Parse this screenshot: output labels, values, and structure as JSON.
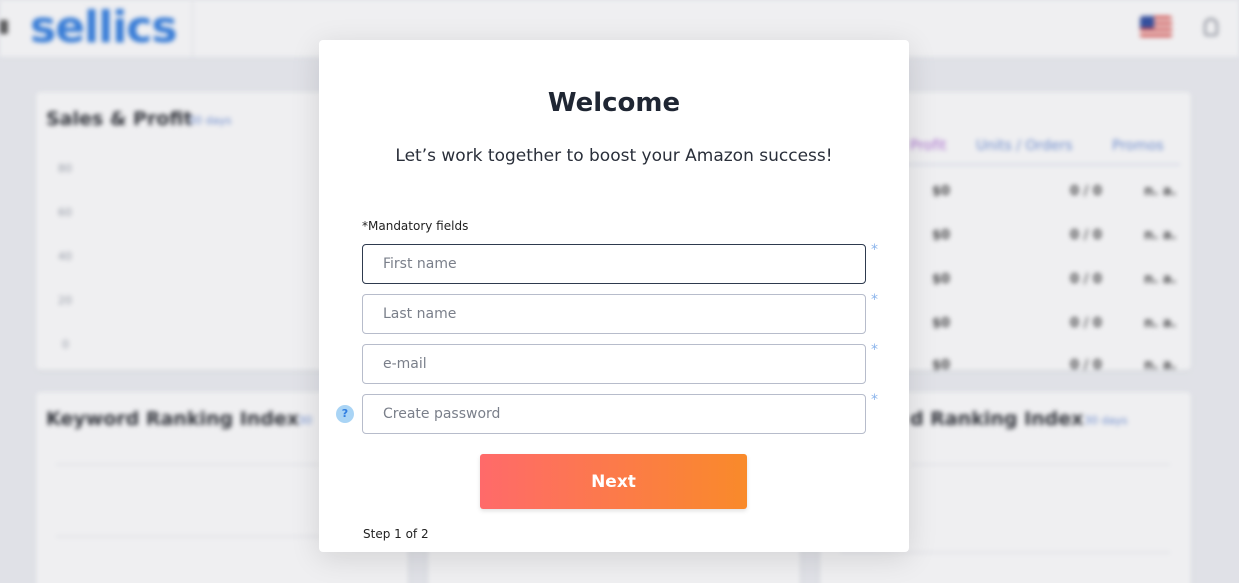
{
  "app": {
    "logo_text": "sellics"
  },
  "background": {
    "sales_card": {
      "title": "Sales & Profit",
      "subtitle": "30 days",
      "ticks": [
        "80",
        "60",
        "40",
        "20",
        "0"
      ]
    },
    "table_card": {
      "tabs": [
        "Profit",
        "Units / Orders",
        "Promos"
      ],
      "rows": [
        [
          "$0",
          "0 / 0",
          "n. a."
        ],
        [
          "$0",
          "0 / 0",
          "n. a."
        ],
        [
          "$0",
          "0 / 0",
          "n. a."
        ],
        [
          "$0",
          "0 / 0",
          "n. a."
        ],
        [
          "$0",
          "0 / 0",
          "n. a."
        ]
      ]
    },
    "keyword_card_left": {
      "title": "Keyword Ranking Index",
      "subtitle": "30"
    },
    "keyword_card_right": {
      "title": "d Ranking Index",
      "subtitle": "30 days"
    }
  },
  "modal": {
    "title": "Welcome",
    "subtitle": "Let’s work together to boost your Amazon success!",
    "mandatory_label": "*Mandatory fields",
    "fields": {
      "first_name": {
        "placeholder": "First name",
        "value": ""
      },
      "last_name": {
        "placeholder": "Last name",
        "value": ""
      },
      "email": {
        "placeholder": "e-mail",
        "value": ""
      },
      "password": {
        "placeholder": "Create password",
        "value": ""
      }
    },
    "required_marker": "*",
    "help_icon_glyph": "?",
    "next_label": "Next",
    "step_label": "Step 1 of 2"
  },
  "colors": {
    "accent_blue": "#2f7de1",
    "button_gradient_start": "#ff6a6a",
    "button_gradient_end": "#f98a2a"
  }
}
